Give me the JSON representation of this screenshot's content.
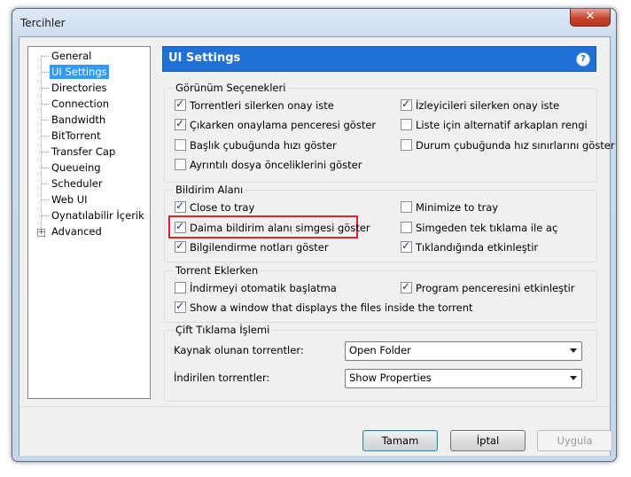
{
  "window": {
    "title": "Tercihler",
    "close_glyph": "✕"
  },
  "tree": {
    "items": [
      {
        "label": "General"
      },
      {
        "label": "UI Settings"
      },
      {
        "label": "Directories"
      },
      {
        "label": "Connection"
      },
      {
        "label": "Bandwidth"
      },
      {
        "label": "BitTorrent"
      },
      {
        "label": "Transfer Cap"
      },
      {
        "label": "Queueing"
      },
      {
        "label": "Scheduler"
      },
      {
        "label": "Web UI"
      },
      {
        "label": "Oynatılabilir İçerik"
      },
      {
        "label": "Advanced"
      }
    ],
    "selected": "UI Settings",
    "expander_glyph": "+"
  },
  "panel": {
    "title": "UI Settings",
    "help_glyph": "?"
  },
  "groups": {
    "appearance": {
      "label": "Görünüm Seçenekleri",
      "options": [
        {
          "label": "Torrentleri silerken onay iste",
          "checked": true
        },
        {
          "label": "İzleyicileri silerken onay iste",
          "checked": true
        },
        {
          "label": "Çıkarken onaylama penceresi göster",
          "checked": true
        },
        {
          "label": "Liste için alternatif arkaplan rengi",
          "checked": false
        },
        {
          "label": "Başlık çubuğunda hızı göster",
          "checked": false
        },
        {
          "label": "Durum çubuğunda hız sınırlarını göster",
          "checked": false
        },
        {
          "label": "Ayrıntılı dosya önceliklerini göster",
          "checked": false
        }
      ]
    },
    "tray": {
      "label": "Bildirim Alanı",
      "options": [
        {
          "label": "Close to tray",
          "checked": true
        },
        {
          "label": "Minimize to tray",
          "checked": false
        },
        {
          "label": "Daima bildirim alanı simgesi göster",
          "checked": true
        },
        {
          "label": "Simgeden tek tıklama ile aç",
          "checked": false
        },
        {
          "label": "Bilgilendirme notları göster",
          "checked": true
        },
        {
          "label": "Tıklandığında etkinleştir",
          "checked": true
        }
      ]
    },
    "adding": {
      "label": "Torrent Eklerken",
      "options": [
        {
          "label": "İndirmeyi otomatik başlatma",
          "checked": false
        },
        {
          "label": "Program penceresini etkinleştir",
          "checked": true
        },
        {
          "label": "Show a window that displays the files inside the torrent",
          "checked": true
        }
      ]
    },
    "doubleclick": {
      "label": "Çift Tıklama İşlemi",
      "seeding_label": "Kaynak olunan torrentler:",
      "seeding_value": "Open Folder",
      "downloading_label": "İndirilen torrentler:",
      "downloading_value": "Show Properties"
    }
  },
  "buttons": {
    "ok": "Tamam",
    "cancel": "İptal",
    "apply": "Uygula"
  },
  "colors": {
    "header_blue": "#1f71d6",
    "highlight_red": "#d9262a",
    "selection": "#3399ff"
  }
}
